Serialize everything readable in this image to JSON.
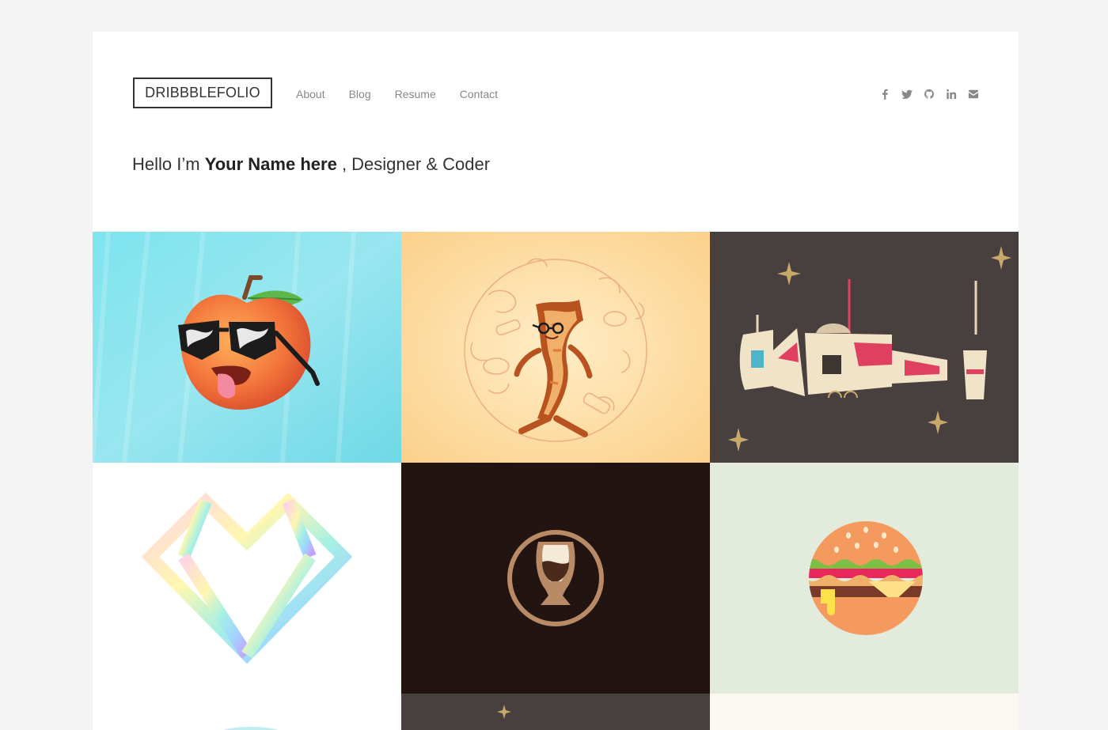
{
  "site": {
    "logo": "DRIBBBLEFOLIO",
    "nav": [
      "About",
      "Blog",
      "Resume",
      "Contact"
    ],
    "social": [
      "facebook-icon",
      "twitter-icon",
      "github-icon",
      "linkedin-icon",
      "envelope-icon"
    ]
  },
  "intro": {
    "prefix": "Hello I’m",
    "name": "Your Name here",
    "suffix": ", Designer & Coder"
  },
  "shots": [
    {
      "subject": "peach-with-sunglasses",
      "bg": "#8ee3ec"
    },
    {
      "subject": "walking-bacon",
      "bg": "#fbd796"
    },
    {
      "subject": "spaceship",
      "bg": "#48403f"
    },
    {
      "subject": "rainbow-diamond",
      "bg": "#ffffff"
    },
    {
      "subject": "beer-glass-badge",
      "bg": "#221410"
    },
    {
      "subject": "burger",
      "bg": "#e2ebdc"
    },
    {
      "subject": "partial-star",
      "bg": "#48403f"
    },
    {
      "subject": "partial-cream",
      "bg": "#fbf8f2"
    }
  ],
  "colors": {
    "text": "#333333",
    "muted": "#888888",
    "page_bg": "#f4f4f4"
  }
}
